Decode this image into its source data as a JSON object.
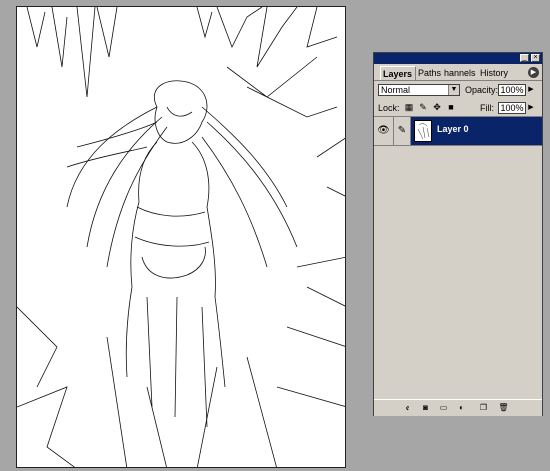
{
  "palette": {
    "tabs": [
      {
        "label": "Layers",
        "active": true
      },
      {
        "label": "Paths",
        "active": false
      },
      {
        "label": "hannels",
        "active": false
      },
      {
        "label": "History",
        "active": false
      }
    ],
    "blend_mode": "Normal",
    "opacity_label": "Opacity:",
    "opacity_value": "100%",
    "lock_label": "Lock:",
    "fill_label": "Fill:",
    "fill_value": "100%",
    "layers": [
      {
        "name": "Layer 0",
        "visible": true,
        "selected": true
      }
    ],
    "icons": {
      "minimize": "minimize-icon",
      "close": "close-icon",
      "menu": "palette-menu-icon",
      "eye": "eye-icon",
      "brush": "brush-icon"
    }
  },
  "colors": {
    "titlebar": "#0a246a",
    "selection": "#0a246a",
    "panel": "#d4d0c8",
    "workspace": "#a6a6a6"
  }
}
